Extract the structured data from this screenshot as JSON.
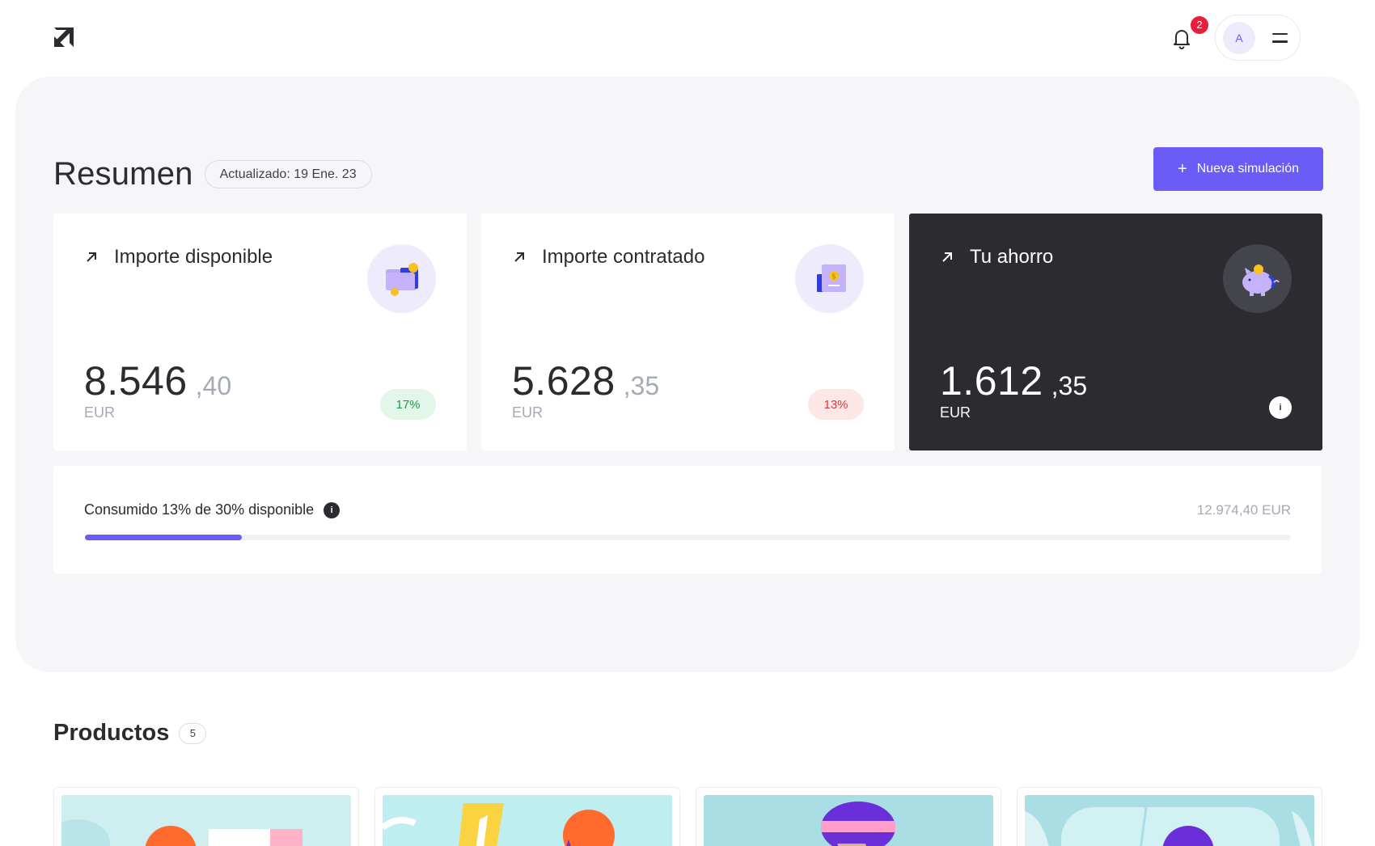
{
  "header": {
    "logo_icon": "arrow-up-right-logo",
    "notifications_count": "2",
    "avatar_initial": "A"
  },
  "summary": {
    "title": "Resumen",
    "updated": "Actualizado: 19 Ene. 23",
    "new_button_icon": "+",
    "new_button_label": "Nueva simulación"
  },
  "cards": [
    {
      "title": "Importe disponible",
      "amount_int": "8.546",
      "amount_dec": ",40",
      "currency": "EUR",
      "badge": "17%",
      "illustration": "wallet-icon"
    },
    {
      "title": "Importe contratado",
      "amount_int": "5.628",
      "amount_dec": ",35",
      "currency": "EUR",
      "badge": "13%",
      "illustration": "document-coin-icon"
    },
    {
      "title": "Tu ahorro",
      "amount_int": "1.612",
      "amount_dec": ",35",
      "currency": "EUR",
      "info": "i",
      "illustration": "piggy-bank-icon"
    }
  ],
  "consumption": {
    "label": "Consumido 13% de 30% disponible",
    "info": "i",
    "total": "12.974,40 EUR",
    "progress_fraction": 0.13
  },
  "products": {
    "title": "Productos",
    "count": "5"
  },
  "colors": {
    "accent": "#6b5cf8",
    "dark_card": "#2b2b30",
    "panel_bg": "#f6f6f9",
    "positive": "#1f9a4a",
    "negative": "#d83a3a",
    "badge_red": "#ec1c3c"
  }
}
